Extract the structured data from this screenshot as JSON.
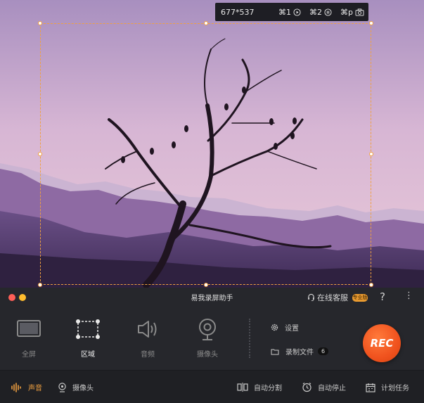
{
  "capture_bar": {
    "dimensions": "677*537",
    "shortcuts": [
      {
        "keys": "⌘1",
        "icon": "play-circle-icon"
      },
      {
        "keys": "⌘2",
        "icon": "pause-circle-icon"
      },
      {
        "keys": "⌘p",
        "icon": "camera-icon"
      }
    ]
  },
  "panel": {
    "title": "易我录屏助手",
    "support_label": "在线客服",
    "pro_badge": "专业版",
    "help": "?",
    "more": "⋮",
    "modes": [
      {
        "label": "全屏",
        "icon": "monitor-icon",
        "active": false
      },
      {
        "label": "区域",
        "icon": "region-select-icon",
        "active": true
      },
      {
        "label": "音频",
        "icon": "speaker-icon",
        "active": false
      },
      {
        "label": "摄像头",
        "icon": "webcam-icon",
        "active": false
      }
    ],
    "settings_label": "设置",
    "recordings_label": "录制文件",
    "recordings_count": "6",
    "rec_label": "REC"
  },
  "bottom_bar": {
    "sound_label": "声音",
    "camera_label": "摄像头",
    "auto_split_label": "自动分割",
    "auto_stop_label": "自动停止",
    "schedule_label": "计划任务"
  },
  "colors": {
    "accent": "#f0a040",
    "rec": "#f0521e",
    "panel_bg": "#26272c",
    "close_dot": "#ff5f57",
    "minimize_dot": "#febc2e"
  }
}
